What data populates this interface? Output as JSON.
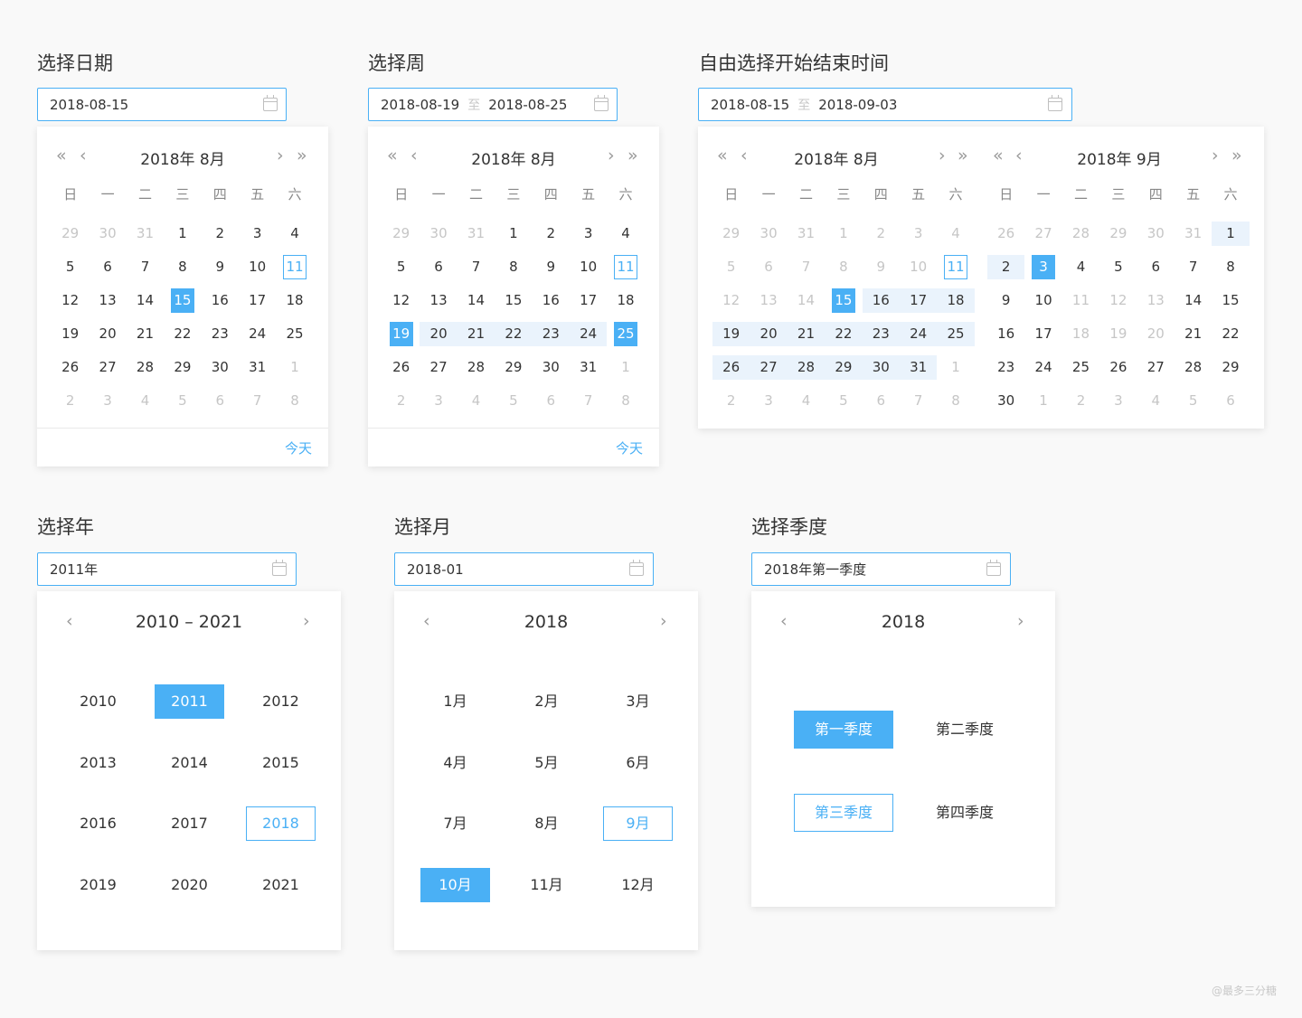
{
  "weekdays": [
    "日",
    "一",
    "二",
    "三",
    "四",
    "五",
    "六"
  ],
  "nav": {
    "prev_year": "«",
    "prev": "‹",
    "next": "›",
    "next_year": "»"
  },
  "date_picker": {
    "title": "选择日期",
    "value": "2018-08-15",
    "header": "2018年 8月",
    "today_label": "今天",
    "days": [
      {
        "d": "29",
        "m": 1
      },
      {
        "d": "30",
        "m": 1
      },
      {
        "d": "31",
        "m": 1
      },
      {
        "d": "1"
      },
      {
        "d": "2"
      },
      {
        "d": "3"
      },
      {
        "d": "4"
      },
      {
        "d": "5"
      },
      {
        "d": "6"
      },
      {
        "d": "7"
      },
      {
        "d": "8"
      },
      {
        "d": "9"
      },
      {
        "d": "10"
      },
      {
        "d": "11",
        "t": 1
      },
      {
        "d": "12"
      },
      {
        "d": "13"
      },
      {
        "d": "14"
      },
      {
        "d": "15",
        "s": 1
      },
      {
        "d": "16"
      },
      {
        "d": "17"
      },
      {
        "d": "18"
      },
      {
        "d": "19"
      },
      {
        "d": "20"
      },
      {
        "d": "21"
      },
      {
        "d": "22"
      },
      {
        "d": "23"
      },
      {
        "d": "24"
      },
      {
        "d": "25"
      },
      {
        "d": "26"
      },
      {
        "d": "27"
      },
      {
        "d": "28"
      },
      {
        "d": "29"
      },
      {
        "d": "30"
      },
      {
        "d": "31"
      },
      {
        "d": "1",
        "m": 1
      },
      {
        "d": "2",
        "m": 1
      },
      {
        "d": "3",
        "m": 1
      },
      {
        "d": "4",
        "m": 1
      },
      {
        "d": "5",
        "m": 1
      },
      {
        "d": "6",
        "m": 1
      },
      {
        "d": "7",
        "m": 1
      },
      {
        "d": "8",
        "m": 1
      }
    ]
  },
  "week_picker": {
    "title": "选择周",
    "start": "2018-08-19",
    "sep": "至",
    "end": "2018-08-25",
    "header": "2018年 8月",
    "today_label": "今天",
    "days": [
      {
        "d": "29",
        "m": 1
      },
      {
        "d": "30",
        "m": 1
      },
      {
        "d": "31",
        "m": 1
      },
      {
        "d": "1"
      },
      {
        "d": "2"
      },
      {
        "d": "3"
      },
      {
        "d": "4"
      },
      {
        "d": "5"
      },
      {
        "d": "6"
      },
      {
        "d": "7"
      },
      {
        "d": "8"
      },
      {
        "d": "9"
      },
      {
        "d": "10"
      },
      {
        "d": "11",
        "t": 1
      },
      {
        "d": "12"
      },
      {
        "d": "13"
      },
      {
        "d": "14"
      },
      {
        "d": "15"
      },
      {
        "d": "16"
      },
      {
        "d": "17"
      },
      {
        "d": "18"
      },
      {
        "d": "19",
        "s": 1
      },
      {
        "d": "20",
        "b": 1
      },
      {
        "d": "21",
        "b": 1
      },
      {
        "d": "22",
        "b": 1
      },
      {
        "d": "23",
        "b": 1
      },
      {
        "d": "24",
        "b": 1
      },
      {
        "d": "25",
        "s": 1
      },
      {
        "d": "26"
      },
      {
        "d": "27"
      },
      {
        "d": "28"
      },
      {
        "d": "29"
      },
      {
        "d": "30"
      },
      {
        "d": "31"
      },
      {
        "d": "1",
        "m": 1
      },
      {
        "d": "2",
        "m": 1
      },
      {
        "d": "3",
        "m": 1
      },
      {
        "d": "4",
        "m": 1
      },
      {
        "d": "5",
        "m": 1
      },
      {
        "d": "6",
        "m": 1
      },
      {
        "d": "7",
        "m": 1
      },
      {
        "d": "8",
        "m": 1
      }
    ]
  },
  "range_picker": {
    "title": "自由选择开始结束时间",
    "start": "2018-08-15",
    "sep": "至",
    "end": "2018-09-03",
    "left_header": "2018年 8月",
    "right_header": "2018年 9月",
    "left_days": [
      {
        "d": "29",
        "m": 1
      },
      {
        "d": "30",
        "m": 1
      },
      {
        "d": "31",
        "m": 1
      },
      {
        "d": "1",
        "m": 1
      },
      {
        "d": "2",
        "m": 1
      },
      {
        "d": "3",
        "m": 1
      },
      {
        "d": "4",
        "m": 1
      },
      {
        "d": "5",
        "m": 1
      },
      {
        "d": "6",
        "m": 1
      },
      {
        "d": "7",
        "m": 1
      },
      {
        "d": "8",
        "m": 1
      },
      {
        "d": "9",
        "m": 1
      },
      {
        "d": "10",
        "m": 1
      },
      {
        "d": "11",
        "t": 1
      },
      {
        "d": "12",
        "m": 1
      },
      {
        "d": "13",
        "m": 1
      },
      {
        "d": "14",
        "m": 1
      },
      {
        "d": "15",
        "s": 1
      },
      {
        "d": "16",
        "b": 1
      },
      {
        "d": "17",
        "b": 1
      },
      {
        "d": "18",
        "b": 1
      },
      {
        "d": "19",
        "b": 1
      },
      {
        "d": "20",
        "b": 1
      },
      {
        "d": "21",
        "b": 1
      },
      {
        "d": "22",
        "b": 1
      },
      {
        "d": "23",
        "b": 1
      },
      {
        "d": "24",
        "b": 1
      },
      {
        "d": "25",
        "b": 1
      },
      {
        "d": "26",
        "b": 1
      },
      {
        "d": "27",
        "b": 1
      },
      {
        "d": "28",
        "b": 1
      },
      {
        "d": "29",
        "b": 1
      },
      {
        "d": "30",
        "b": 1
      },
      {
        "d": "31",
        "b": 1
      },
      {
        "d": "1",
        "m": 1
      },
      {
        "d": "2",
        "m": 1
      },
      {
        "d": "3",
        "m": 1
      },
      {
        "d": "4",
        "m": 1
      },
      {
        "d": "5",
        "m": 1
      },
      {
        "d": "6",
        "m": 1
      },
      {
        "d": "7",
        "m": 1
      },
      {
        "d": "8",
        "m": 1
      }
    ],
    "right_days": [
      {
        "d": "26",
        "m": 1
      },
      {
        "d": "27",
        "m": 1
      },
      {
        "d": "28",
        "m": 1
      },
      {
        "d": "29",
        "m": 1
      },
      {
        "d": "30",
        "m": 1
      },
      {
        "d": "31",
        "m": 1
      },
      {
        "d": "1",
        "b": 1
      },
      {
        "d": "2",
        "b": 1
      },
      {
        "d": "3",
        "s": 1
      },
      {
        "d": "4"
      },
      {
        "d": "5"
      },
      {
        "d": "6"
      },
      {
        "d": "7"
      },
      {
        "d": "8"
      },
      {
        "d": "9"
      },
      {
        "d": "10"
      },
      {
        "d": "11",
        "m": 1
      },
      {
        "d": "12",
        "m": 1
      },
      {
        "d": "13",
        "m": 1
      },
      {
        "d": "14"
      },
      {
        "d": "15"
      },
      {
        "d": "16"
      },
      {
        "d": "17"
      },
      {
        "d": "18",
        "m": 1
      },
      {
        "d": "19",
        "m": 1
      },
      {
        "d": "20",
        "m": 1
      },
      {
        "d": "21"
      },
      {
        "d": "22"
      },
      {
        "d": "23"
      },
      {
        "d": "24"
      },
      {
        "d": "25"
      },
      {
        "d": "26"
      },
      {
        "d": "27"
      },
      {
        "d": "28"
      },
      {
        "d": "29"
      },
      {
        "d": "30"
      },
      {
        "d": "1",
        "m": 1
      },
      {
        "d": "2",
        "m": 1
      },
      {
        "d": "3",
        "m": 1
      },
      {
        "d": "4",
        "m": 1
      },
      {
        "d": "5",
        "m": 1
      },
      {
        "d": "6",
        "m": 1
      }
    ]
  },
  "year_picker": {
    "title": "选择年",
    "value": "2011年",
    "header": "2010 – 2021",
    "cells": [
      {
        "v": "2010"
      },
      {
        "v": "2011",
        "s": 1
      },
      {
        "v": "2012"
      },
      {
        "v": "2013"
      },
      {
        "v": "2014"
      },
      {
        "v": "2015"
      },
      {
        "v": "2016"
      },
      {
        "v": "2017"
      },
      {
        "v": "2018",
        "c": 1
      },
      {
        "v": "2019"
      },
      {
        "v": "2020"
      },
      {
        "v": "2021"
      }
    ]
  },
  "month_picker": {
    "title": "选择月",
    "value": "2018-01",
    "header": "2018",
    "cells": [
      {
        "v": "1月"
      },
      {
        "v": "2月"
      },
      {
        "v": "3月"
      },
      {
        "v": "4月"
      },
      {
        "v": "5月"
      },
      {
        "v": "6月"
      },
      {
        "v": "7月"
      },
      {
        "v": "8月"
      },
      {
        "v": "9月",
        "c": 1
      },
      {
        "v": "10月",
        "s": 1
      },
      {
        "v": "11月"
      },
      {
        "v": "12月"
      }
    ]
  },
  "quarter_picker": {
    "title": "选择季度",
    "value": "2018年第一季度",
    "header": "2018",
    "cells": [
      {
        "v": "第一季度",
        "s": 1
      },
      {
        "v": "第二季度"
      },
      {
        "v": "第三季度",
        "c": 1
      },
      {
        "v": "第四季度"
      }
    ]
  },
  "watermark": "@最多三分糖",
  "colors": {
    "accent": "#4ab0f5",
    "range_band": "#eaf3fc",
    "muted_text": "#c6c6c6"
  }
}
